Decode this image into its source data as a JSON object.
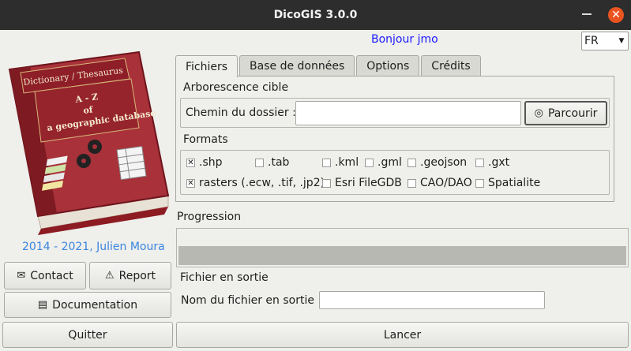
{
  "window": {
    "title": "DicoGIS 3.0.0",
    "close_glyph": "✕"
  },
  "header": {
    "greeting": "Bonjour jmo",
    "language": "FR"
  },
  "logo": {
    "banner": "Dictionary / Thesaurus",
    "line1": "A - Z",
    "line2": "of",
    "line3": "a geographic database"
  },
  "credit": "2014 - 2021, Julien Moura",
  "left_buttons": {
    "contact": "Contact",
    "report": "Report",
    "documentation": "Documentation",
    "quit": "Quitter"
  },
  "tabs": [
    {
      "label": "Fichiers",
      "active": true
    },
    {
      "label": "Base de données",
      "active": false
    },
    {
      "label": "Options",
      "active": false
    },
    {
      "label": "Crédits",
      "active": false
    }
  ],
  "files_tab": {
    "target_section": "Arborescence cible",
    "folder_label": "Chemin du dossier :",
    "folder_value": "",
    "browse_label": "Parcourir",
    "formats_section": "Formats",
    "formats_row1": [
      {
        "label": ".shp",
        "checked": true
      },
      {
        "label": ".tab",
        "checked": false
      },
      {
        "label": ".kml",
        "checked": false
      },
      {
        "label": ".gml",
        "checked": false
      },
      {
        "label": ".geojson",
        "checked": false
      },
      {
        "label": ".gxt",
        "checked": false
      }
    ],
    "formats_row2": [
      {
        "label": "rasters (.ecw, .tif, .jp2)",
        "checked": true
      },
      {
        "label": "Esri FileGDB",
        "checked": false
      },
      {
        "label": "CAO/DAO",
        "checked": false
      },
      {
        "label": "Spatialite",
        "checked": false
      }
    ]
  },
  "progress": {
    "label": "Progression",
    "value": 0
  },
  "output": {
    "section": "Fichier en sortie",
    "name_label": "Nom du fichier en sortie :",
    "name_value": ""
  },
  "launch_label": "Lancer"
}
